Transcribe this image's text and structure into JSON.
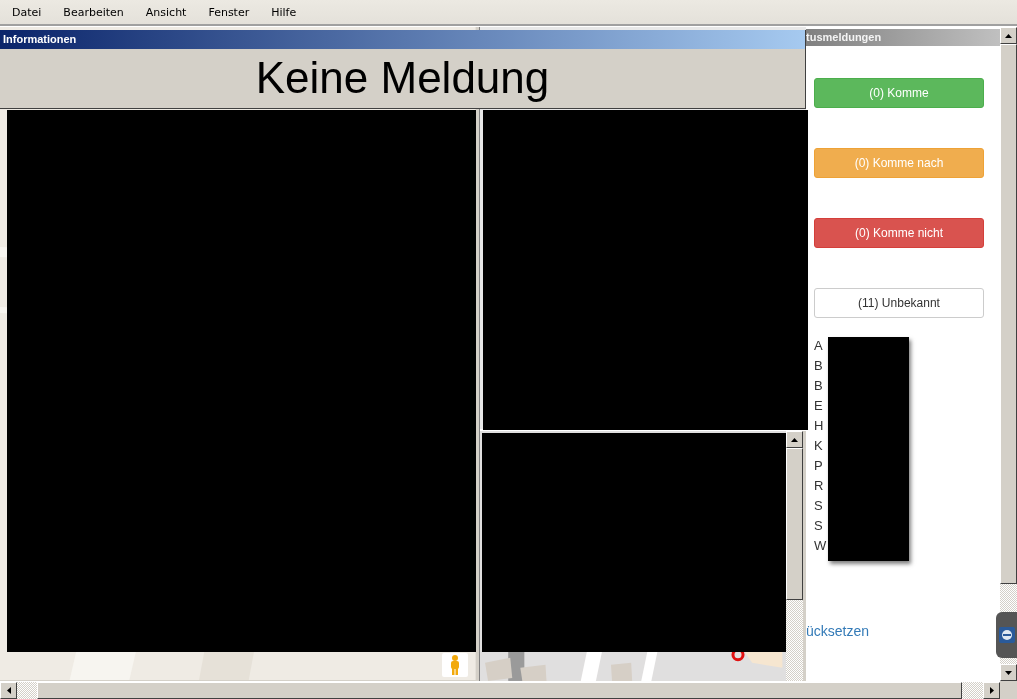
{
  "menu": [
    {
      "label": "Datei"
    },
    {
      "label": "Bearbeiten"
    },
    {
      "label": "Ansicht"
    },
    {
      "label": "Fenster"
    },
    {
      "label": "Hilfe"
    }
  ],
  "info_window": {
    "title": "Informationen",
    "message": "Keine Meldung"
  },
  "status_panel": {
    "title": "tusmeldungen",
    "buttons": [
      {
        "label": "(0) Komme",
        "kind": "success"
      },
      {
        "label": "(0) Komme nach",
        "kind": "warning"
      },
      {
        "label": "(0) Komme nicht",
        "kind": "danger"
      },
      {
        "label": "(11) Unbekannt",
        "kind": "default"
      }
    ],
    "names": [
      "A",
      "B",
      "B",
      "E",
      "H",
      "K",
      "P",
      "R",
      "S",
      "S",
      "W"
    ],
    "reset_link": "ücksetzen"
  }
}
